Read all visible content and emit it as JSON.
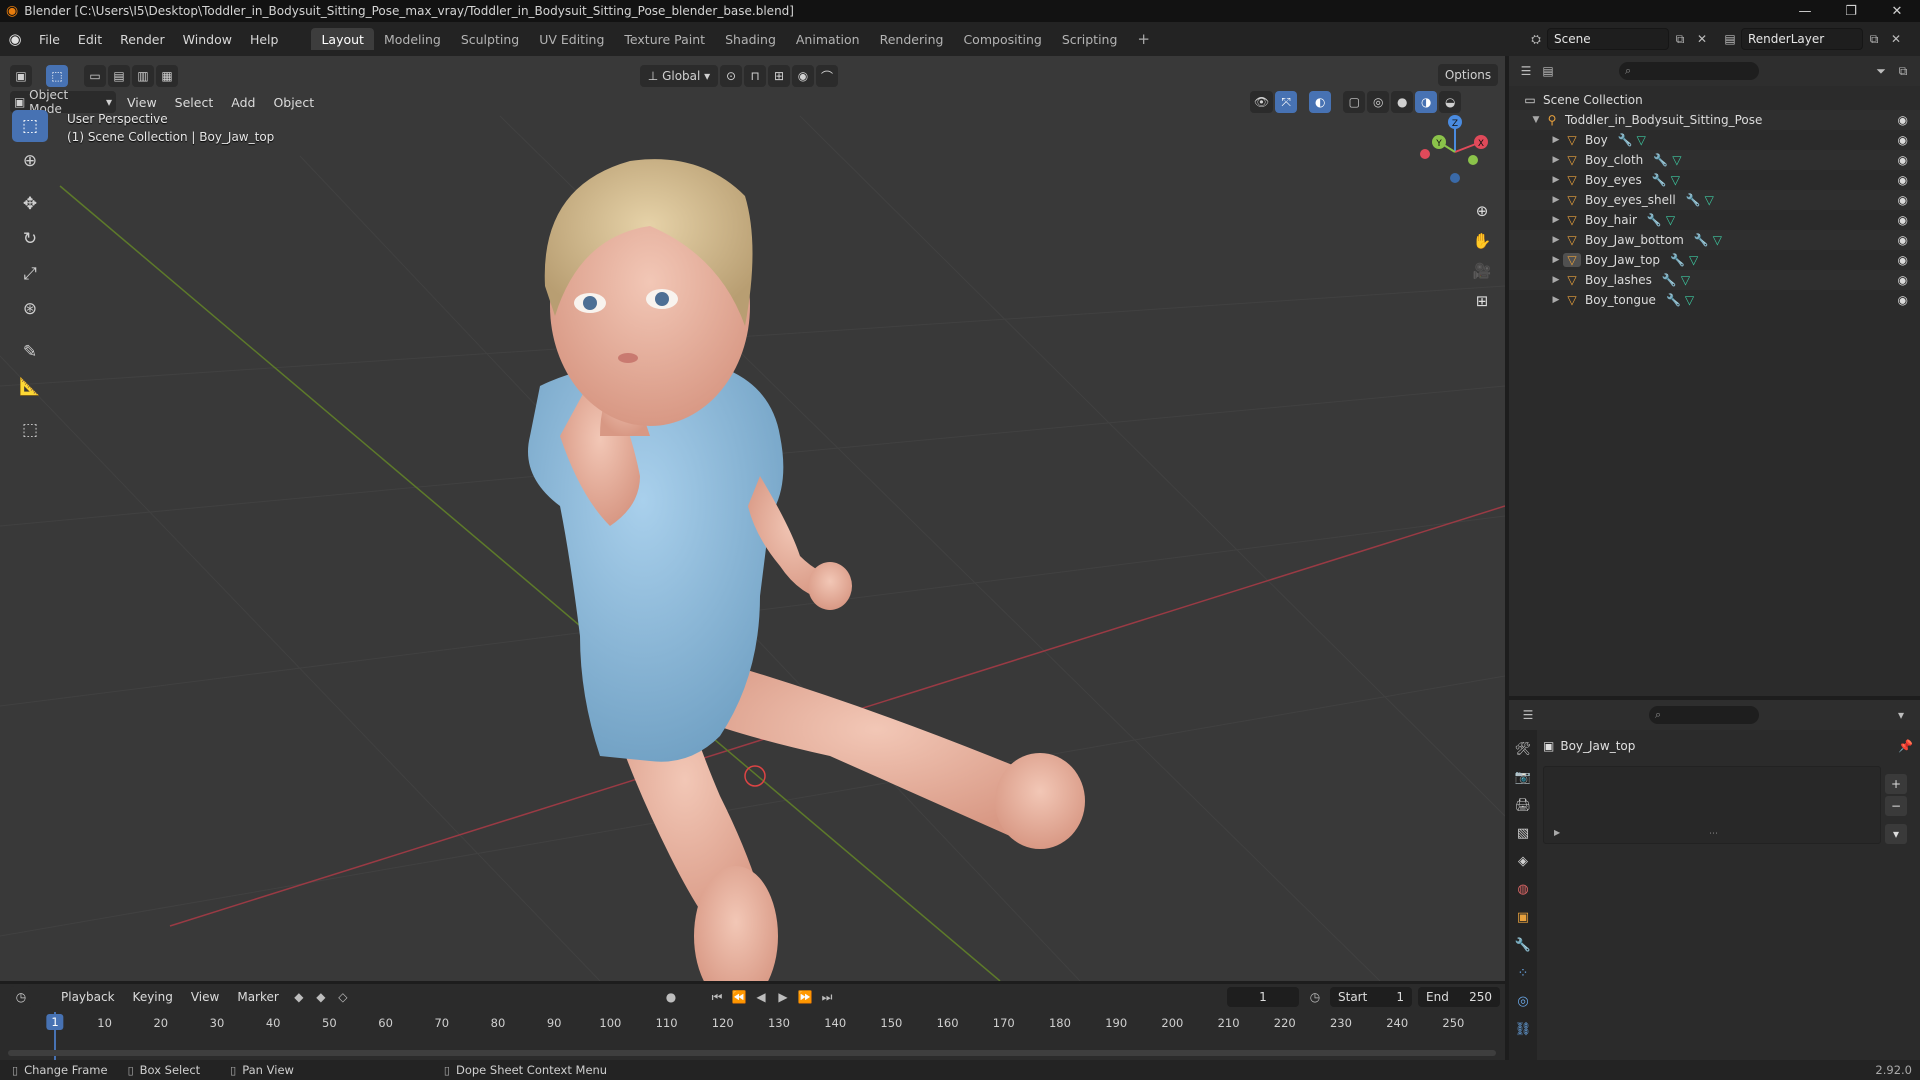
{
  "window": {
    "title": "Blender [C:\\Users\\I5\\Desktop\\Toddler_in_Bodysuit_Sitting_Pose_max_vray/Toddler_in_Bodysuit_Sitting_Pose_blender_base.blend]",
    "minimize": "—",
    "maximize": "❐",
    "close": "✕"
  },
  "menubar": {
    "file": "File",
    "edit": "Edit",
    "render": "Render",
    "window": "Window",
    "help": "Help",
    "workspaces": [
      "Layout",
      "Modeling",
      "Sculpting",
      "UV Editing",
      "Texture Paint",
      "Shading",
      "Animation",
      "Rendering",
      "Compositing",
      "Scripting"
    ],
    "active_workspace": "Layout",
    "add_workspace": "+",
    "scene": "Scene",
    "render_layer": "RenderLayer"
  },
  "viewport": {
    "transform_orientation": "Global",
    "options": "Options",
    "mode": "Object Mode",
    "menus": [
      "View",
      "Select",
      "Add",
      "Object"
    ],
    "perspective": "User Perspective",
    "collection_info": "(1) Scene Collection | Boy_Jaw_top",
    "gizmo": {
      "x": "X",
      "y": "Y",
      "z": "Z"
    }
  },
  "outliner": {
    "root": "Scene Collection",
    "collection": "Toddler_in_Bodysuit_Sitting_Pose",
    "objects": [
      "Boy",
      "Boy_cloth",
      "Boy_eyes",
      "Boy_eyes_shell",
      "Boy_hair",
      "Boy_Jaw_bottom",
      "Boy_Jaw_top",
      "Boy_lashes",
      "Boy_tongue"
    ]
  },
  "properties": {
    "object_name": "Boy_Jaw_top"
  },
  "timeline": {
    "menus": [
      "Playback",
      "Keying",
      "View",
      "Marker"
    ],
    "current_frame": "1",
    "start_label": "Start",
    "start_value": "1",
    "end_label": "End",
    "end_value": "250",
    "ticks": [
      "10",
      "20",
      "30",
      "40",
      "50",
      "60",
      "70",
      "80",
      "90",
      "100",
      "110",
      "120",
      "130",
      "140",
      "150",
      "160",
      "170",
      "180",
      "190",
      "200",
      "210",
      "220",
      "230",
      "240",
      "250"
    ]
  },
  "statusbar": {
    "change_frame": "Change Frame",
    "box_select": "Box Select",
    "pan_view": "Pan View",
    "context_menu": "Dope Sheet Context Menu",
    "version": "2.92.0"
  },
  "colors": {
    "accent": "#4772b3",
    "x_axis": "#e04a5a",
    "y_axis": "#8bc34a",
    "z_axis": "#4a8be0",
    "object_orange": "#e8a13d"
  }
}
